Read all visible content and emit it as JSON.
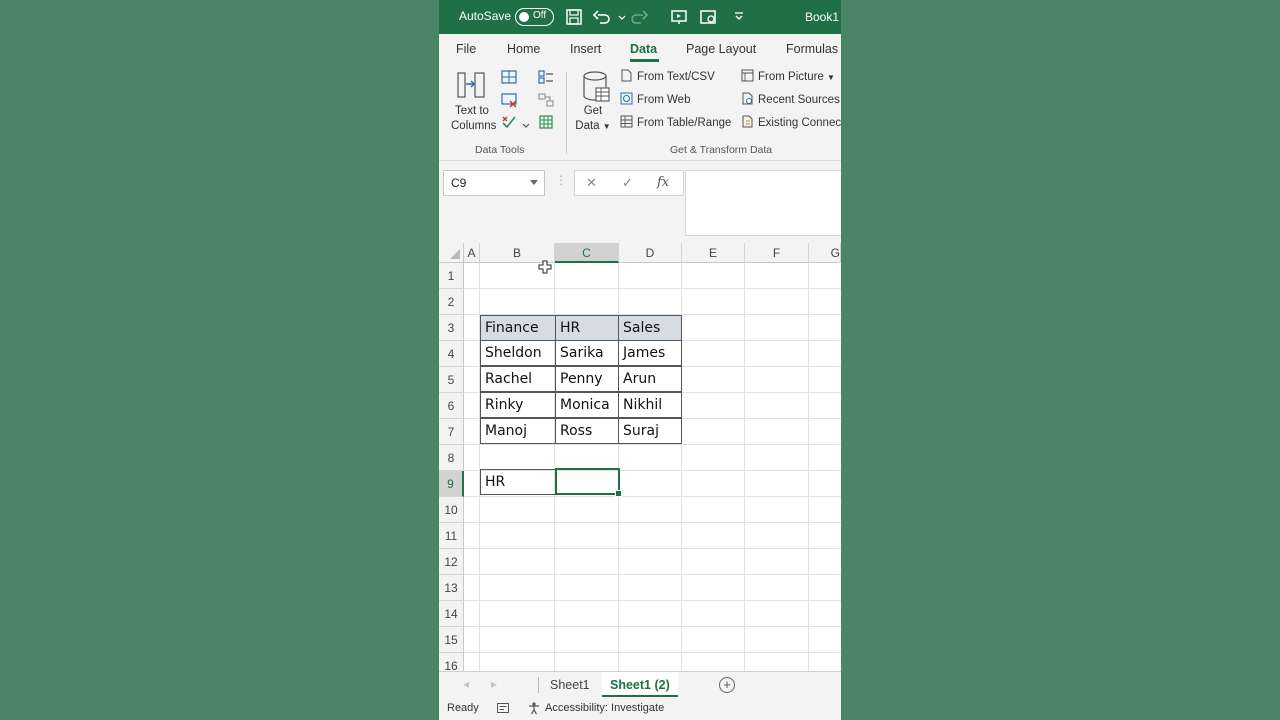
{
  "titlebar": {
    "autosave_label": "AutoSave",
    "autosave_state": "Off",
    "book_title": "Book1",
    "icons": [
      "save-icon",
      "undo-icon",
      "redo-icon",
      "present-icon",
      "screenshot-icon",
      "customize-icon"
    ]
  },
  "ribbon_tabs": [
    {
      "label": "File",
      "active": false
    },
    {
      "label": "Home",
      "active": false
    },
    {
      "label": "Insert",
      "active": false
    },
    {
      "label": "Data",
      "active": true
    },
    {
      "label": "Page Layout",
      "active": false
    },
    {
      "label": "Formulas",
      "active": false
    }
  ],
  "ribbon": {
    "text_to_columns": "Text to Columns",
    "text_to_line1": "Text to",
    "text_to_line2": "Columns",
    "data_tools_label": "Data Tools",
    "get_data_line1": "Get",
    "get_data_line2": "Data",
    "from_text_csv": "From Text/CSV",
    "from_web": "From Web",
    "from_table_range": "From Table/Range",
    "from_picture": "From Picture",
    "recent_sources": "Recent Sources",
    "existing_connections": "Existing Connec",
    "get_transform_label": "Get & Transform Data"
  },
  "formula_bar": {
    "name_box": "C9",
    "cancel_symbol": "✕",
    "enter_symbol": "✓",
    "fx_symbol": "fx",
    "formula": ""
  },
  "columns": [
    "A",
    "B",
    "C",
    "D",
    "E",
    "F",
    "G"
  ],
  "selected_column": "C",
  "rows": [
    "1",
    "2",
    "3",
    "4",
    "5",
    "6",
    "7",
    "8",
    "9",
    "10",
    "11",
    "12",
    "13",
    "14",
    "15",
    "16"
  ],
  "selected_row": "9",
  "table": {
    "headers": [
      "Finance",
      "HR",
      "Sales"
    ],
    "rows": [
      [
        "Sheldon",
        "Sarika",
        "James"
      ],
      [
        "Rachel",
        "Penny",
        "Arun"
      ],
      [
        "Rinky",
        "Monica",
        "Nikhil"
      ],
      [
        "Manoj",
        "Ross",
        "Suraj"
      ]
    ]
  },
  "lookup": {
    "label": "HR",
    "value": ""
  },
  "sheets": [
    {
      "label": "Sheet1",
      "active": false
    },
    {
      "label": "Sheet1 (2)",
      "active": true
    }
  ],
  "status": {
    "ready": "Ready",
    "accessibility": "Accessibility: Investigate"
  },
  "colors": {
    "accent": "#1f7145",
    "header_fill": "#d6dce4",
    "background": "#4a8566"
  }
}
